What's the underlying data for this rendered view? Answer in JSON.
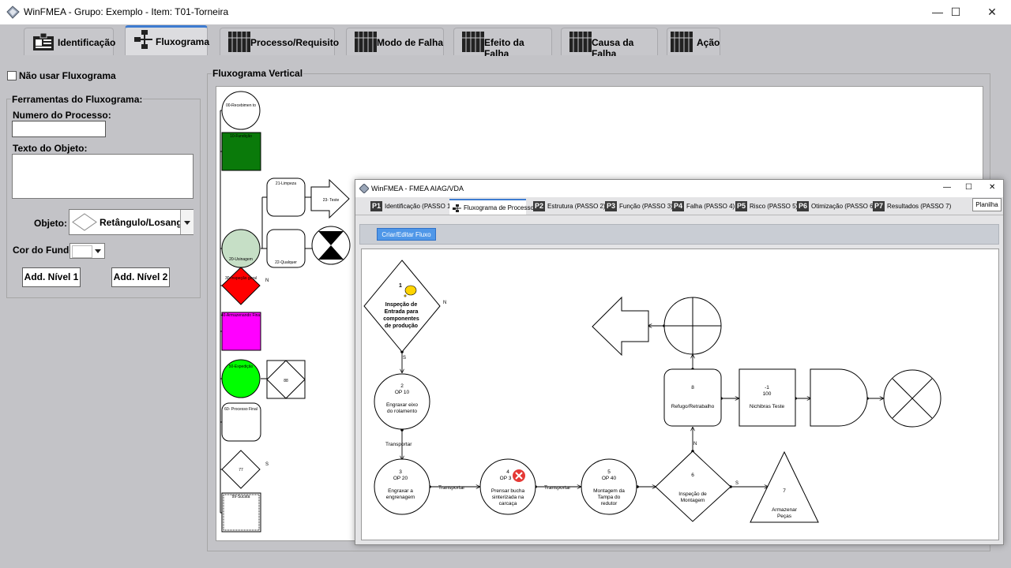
{
  "window": {
    "title": "WinFMEA  -  Grupo: Exemplo  -  Item: T01-Torneira",
    "minimize": "—",
    "maximize": "☐",
    "close": "✕"
  },
  "tabs": [
    {
      "label": "Identificação",
      "icon": "id-card-icon"
    },
    {
      "label": "Fluxograma",
      "icon": "flowchart-icon"
    },
    {
      "label": "Processo/Requisito",
      "icon": "grid-icon"
    },
    {
      "label": "Modo de Falha",
      "icon": "grid-icon"
    },
    {
      "label": "Efeito da Falha",
      "icon": "grid-icon"
    },
    {
      "label": "Causa da Falha",
      "icon": "grid-icon"
    },
    {
      "label": "Ação",
      "icon": "grid-icon"
    }
  ],
  "left": {
    "no_flow_checkbox": "Não usar Fluxograma",
    "tools_title": "Ferramentas do Fluxograma:",
    "process_number_label": "Numero do Processo:",
    "process_number_value": "",
    "object_text_label": "Texto do Objeto:",
    "object_text_value": "",
    "object_label": "Objeto:",
    "object_value": "Retângulo/Losang",
    "bg_color_label": "Cor do Fundo",
    "add_level1": "Add. Nível 1",
    "add_level2": "Add. Nível 2"
  },
  "vertical_flow": {
    "title": "Fluxograma Vertical",
    "shapes": {
      "s00": "00-Recebimen to",
      "s10": "10-Fundição",
      "s21": "21-Limpeza",
      "s23": "23- Teste",
      "s20": "20-Usinagem",
      "s22": "22-Qualquer",
      "s30": "30-Inspeção geral",
      "s30_flag": "N",
      "s40": "40-Armazenando Final",
      "s50": "50-Expedição",
      "s88": "88",
      "s60": "60- Processo Final",
      "s77": "77",
      "s77_flag": "S",
      "s99": "99-Sucata"
    }
  },
  "inner_window": {
    "title": "WinFMEA - FMEA AIAG/VDA",
    "minimize": "—",
    "maximize": "☐",
    "close": "✕",
    "tabs": [
      {
        "badge": "P1",
        "label": "Identificação (PASSO 1)"
      },
      {
        "badge": "",
        "label": "Fluxograma de Processo"
      },
      {
        "badge": "P2",
        "label": "Estrutura (PASSO 2)"
      },
      {
        "badge": "P3",
        "label": "Função (PASSO 3)"
      },
      {
        "badge": "P4",
        "label": "Falha (PASSO 4)"
      },
      {
        "badge": "P5",
        "label": "Risco (PASSO 5)"
      },
      {
        "badge": "P6",
        "label": "Otimização (PASSO 6)"
      },
      {
        "badge": "P7",
        "label": "Resultados (PASSO 7)"
      }
    ],
    "spreadsheet_button": "Planilha",
    "create_flow_button": "Criar/Editar Fluxo",
    "flow": {
      "n1_num": "1",
      "n1_l1": "Inspeção de",
      "n1_l2": "Entrada para",
      "n1_l3": "componentes",
      "n1_l4": "de produção",
      "n1_no": "N",
      "n1_yes": "S",
      "n2_num": "2",
      "n2_op": "OP 10",
      "n2_l1": "Engraxar eixo",
      "n2_l2": "do rolamento",
      "t1": "Transportar",
      "n3_num": "3",
      "n3_op": "OP 20",
      "n3_l1": "Engraxar a",
      "n3_l2": "engrenagem",
      "t2": "Transportar",
      "n4_num": "4",
      "n4_op": "OP 3",
      "n4_l1": "Prensar bucha",
      "n4_l2": "sinterizada na",
      "n4_l3": "carcaça",
      "t3": "Transportar",
      "n5_num": "5",
      "n5_op": "OP 40",
      "n5_l1": "Montagem da",
      "n5_l2": "Tampa do",
      "n5_l3": "redutor",
      "n6_num": "6",
      "n6_l1": "Inspeção de",
      "n6_l2": "Montagem",
      "n6_yes": "S",
      "n6_no": "N",
      "n7_num": "7",
      "n7_l1": "Armazenar",
      "n7_l2": "Peças",
      "n8_num": "8",
      "n8_l1": "Refugo/Retrabalho",
      "n9_num": "-1",
      "n9_l1": "100",
      "n9_l2": "Nichibras Teste"
    }
  },
  "colors": {
    "accent": "#3d7bd0",
    "green_dark": "#0a7a0a",
    "green_light": "#c6dfc6",
    "red": "#ff0000",
    "magenta": "#ff00ff",
    "green_bright": "#00ff00"
  }
}
